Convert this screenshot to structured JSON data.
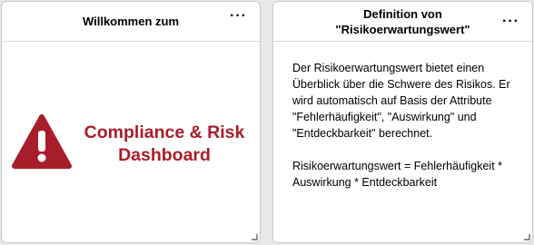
{
  "widgets": [
    {
      "title": "Willkommen zum",
      "menu_label": "···",
      "logo": {
        "icon": "warning-icon",
        "line1": "Compliance & Risk",
        "line2": "Dashboard",
        "color": "#a91d2a"
      }
    },
    {
      "title": "Definition von\n\"Risikoerwartungswert\"",
      "menu_label": "···",
      "paragraph1": "Der Risikoerwartungswert bietet einen Überblick über die Schwere des Risikos. Er wird automatisch auf Basis der Attribute \"Fehlerhäufigkeit\", \"Auswirkung\" und \"Entdeckbarkeit\" berechnet.",
      "paragraph2": "Risikoerwartungswert = Fehlerhäufigkeit * Auswirkung * Entdeckbarkeit"
    }
  ]
}
